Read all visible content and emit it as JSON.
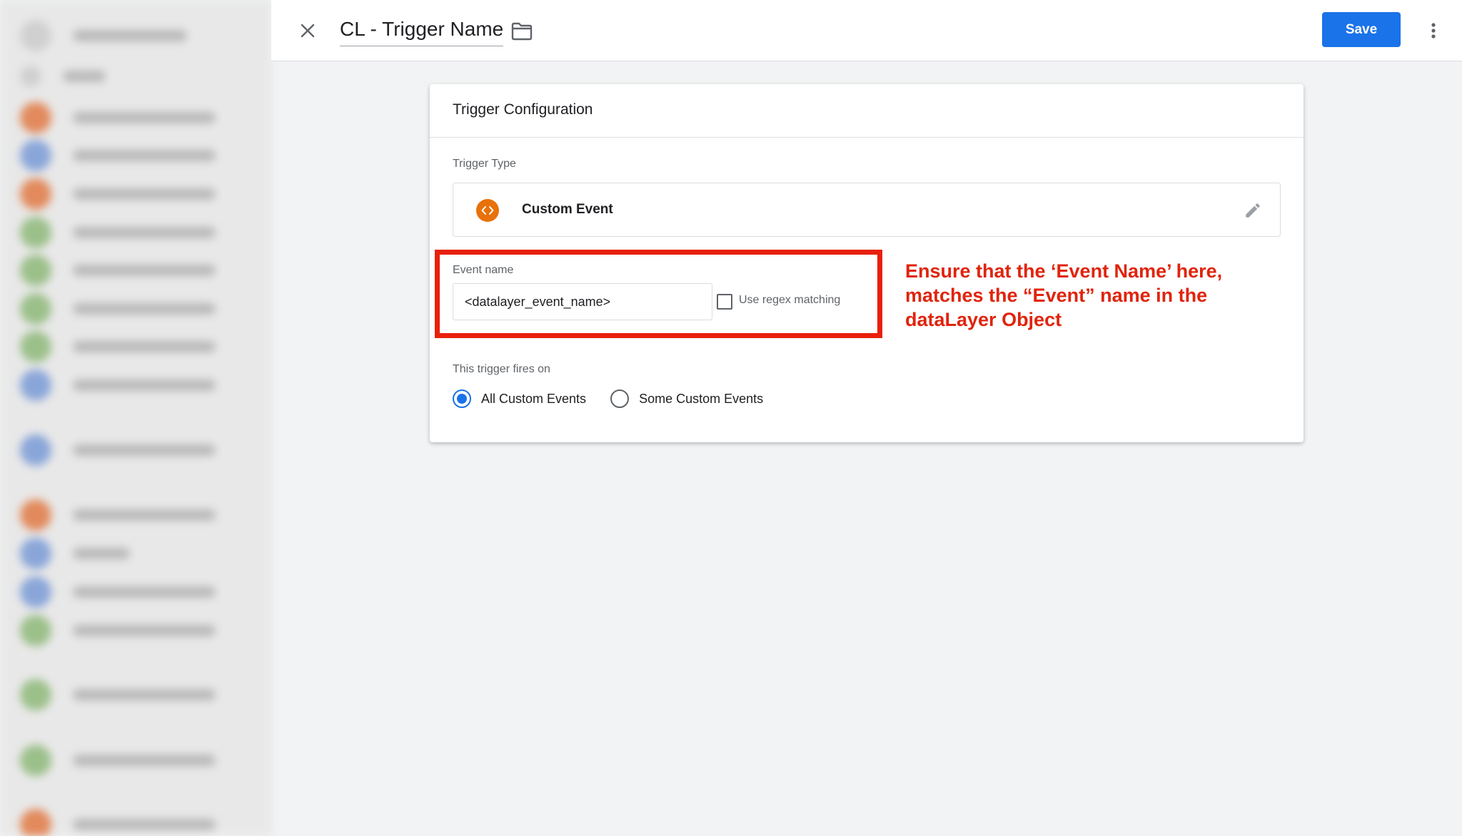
{
  "header": {
    "title": "CL - Trigger Name",
    "save_label": "Save"
  },
  "card": {
    "title": "Trigger Configuration",
    "trigger_type_label": "Trigger Type",
    "trigger_type_name": "Custom Event",
    "event_name_label": "Event name",
    "event_name_value": "<datalayer_event_name>",
    "regex_label": "Use regex matching",
    "fires_on_label": "This trigger fires on",
    "fires_on_options": [
      {
        "label": "All Custom Events",
        "selected": true
      },
      {
        "label": "Some Custom Events",
        "selected": false
      }
    ]
  },
  "annotation": {
    "text": "Ensure that the ‘Event Name’ here, matches the “Event” name in the dataLayer Object"
  },
  "colors": {
    "accent": "#1a73e8",
    "trigger_icon": "#e8710a",
    "annotation": "#e0240d"
  }
}
